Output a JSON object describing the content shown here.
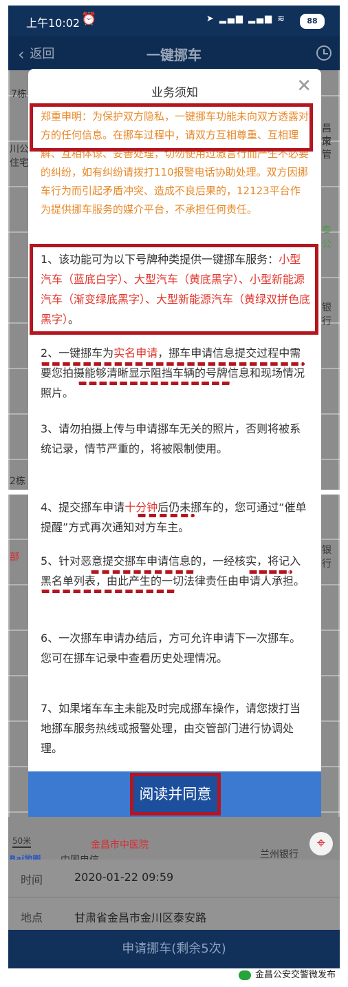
{
  "status_bar": {
    "time": "上午10:02",
    "battery": "88"
  },
  "nav": {
    "back_label": "返回",
    "title": "一键挪车"
  },
  "map": {
    "label_7dong_top": "7栋",
    "label_chuangong": "川公",
    "label_zhuzhai": "住宅",
    "label_changshi": "昌市",
    "label_jiaoguan": "交管",
    "label_taigong": "泰公",
    "label_yinhang": "银行",
    "label_2dong": "2栋",
    "label_bu": "部",
    "label_scale": "50米",
    "label_hospital": "金昌市中医院",
    "label_telecom": "中国电信",
    "label_bank": "兰州银行",
    "label_baidu": "Bai地图"
  },
  "dialog": {
    "title": "业务须知",
    "notice": "郑重申明：为保护双方隐私，一键挪车功能未向双方透露对方的任何信息。在挪车过程中，请双方互相尊重、互相理解、互相体谅、妥善处理，切勿使用过激言行而产生不必要的纠纷，如有纠纷请拨打110报警电话协助处理。双方因挪车行为而引起矛盾冲突、造成不良后果的，12123平台作为提供挪车服务的媒介平台，不承担任何责任。",
    "item1_prefix": "1、该功能可为以下号牌种类提供一键挪车服务：",
    "item1_types": "小型汽车（蓝底白字）、大型汽车（黄底黑字）、小型新能源汽车（渐变绿底黑字）、大型新能源汽车（黄绿双拼色底黑字）",
    "item1_suffix": "。",
    "item2_a": "2、一键挪车为",
    "item2_red": "实名申请",
    "item2_b": "，挪车申请信息提交过程中需要您拍摄能够清晰显示阻挡车辆的号牌信息和现场情况照片。",
    "item3": "3、请勿拍摄上传与申请挪车无关的照片，否则将被系统记录，情节严重的，将被限制使用。",
    "item4_a": "4、提交挪车申请",
    "item4_red": "十分钟",
    "item4_b": "后仍未挪车的，您可通过“催单提醒”方式再次通知对方车主。",
    "item5": "5、针对恶意提交挪车申请信息的，一经核实，将记入黑名单列表，由此产生的一切法律责任由申请人承担。",
    "item6": "6、一次挪车申请办结后，方可允许申请下一次挪车。您可在挪车记录中查看历史处理情况。",
    "item7": "7、如果堵车车主未能及时完成挪车操作，请您拨打当地挪车服务热线或报警处理，由交管部门进行协调处理。",
    "agree_label": "阅读并同意"
  },
  "info": {
    "time_label": "时间",
    "time_value": "2020-01-22 09:59",
    "place_label": "地点",
    "place_value": "甘肃省金昌市金川区泰安路"
  },
  "submit_label": "申请挪车(剩余5次)",
  "watermark": "金昌公安交警微发布",
  "colors": {
    "nav_bg": "#0e2c52",
    "notice_orange": "#e8892a",
    "highlight_red": "#e1362d",
    "annotation_red": "#b3161e",
    "agree_blue": "#3c7ad2"
  }
}
